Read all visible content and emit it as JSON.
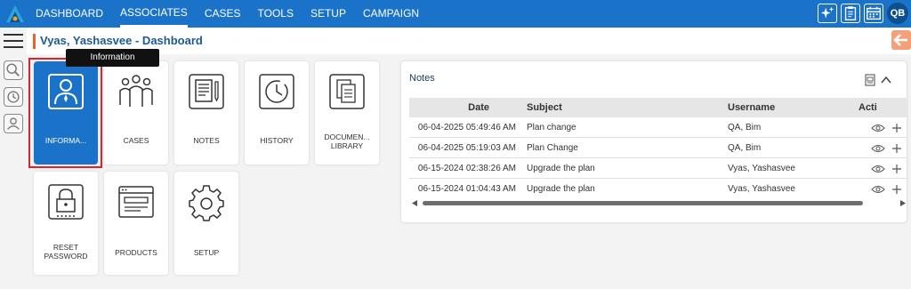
{
  "nav": {
    "items": [
      "DASHBOARD",
      "ASSOCIATES",
      "CASES",
      "TOOLS",
      "SETUP",
      "CAMPAIGN"
    ],
    "active": "ASSOCIATES"
  },
  "user": {
    "initials": "QB"
  },
  "page": {
    "title": "Vyas, Yashasvee - Dashboard"
  },
  "tooltip": "Information",
  "tiles": [
    {
      "label": "INFORMA...",
      "icon": "person-icon"
    },
    {
      "label": "CASES",
      "icon": "group-icon"
    },
    {
      "label": "NOTES",
      "icon": "notes-icon"
    },
    {
      "label": "HISTORY",
      "icon": "clock-icon"
    },
    {
      "label": "DOCUMEN... LIBRARY",
      "icon": "documents-icon"
    },
    {
      "label": "RESET PASSWORD",
      "icon": "lock-icon"
    },
    {
      "label": "PRODUCTS",
      "icon": "products-icon"
    },
    {
      "label": "SETUP",
      "icon": "gear-icon"
    }
  ],
  "notes": {
    "title": "Notes",
    "columns": {
      "date": "Date",
      "subject": "Subject",
      "username": "Username",
      "actions": "Acti"
    },
    "rows": [
      {
        "date": "06-04-2025 05:49:46 AM",
        "subject": "Plan change",
        "username": "QA, Bim"
      },
      {
        "date": "06-04-2025 05:19:03 AM",
        "subject": "Plan Change",
        "username": "QA, Bim"
      },
      {
        "date": "06-15-2024 02:38:26 AM",
        "subject": "Upgrade the plan",
        "username": "Vyas, Yashasvee"
      },
      {
        "date": "06-15-2024 01:04:43 AM",
        "subject": "Upgrade the plan",
        "username": "Vyas, Yashasvee"
      }
    ]
  },
  "colors": {
    "brand": "#1a73c8",
    "accent": "#e8602c",
    "highlight": "#e0222b"
  }
}
